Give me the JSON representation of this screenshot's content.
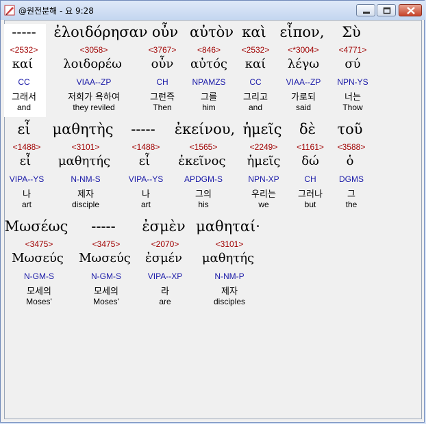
{
  "window": {
    "title": "@원전분해 - 요 9:28"
  },
  "rows": [
    {
      "words": [
        {
          "greek": "-----",
          "strong": "<2532>",
          "lemma": "καί",
          "morph": "CC",
          "korean": "그래서",
          "english": "and"
        },
        {
          "greek": "ἐλοιδόρησαν",
          "strong": "<3058>",
          "lemma": "λοιδορέω",
          "morph": "VIAA--ZP",
          "korean": "저희가 욕하여",
          "english": "they reviled"
        },
        {
          "greek": "οὖν",
          "strong": "<3767>",
          "lemma": "οὖν",
          "morph": "CH",
          "korean": "그런즉",
          "english": "Then"
        },
        {
          "greek": "αὐτὸν",
          "strong": "<846>",
          "lemma": "αὐτός",
          "morph": "NPAMZS",
          "korean": "그를",
          "english": "him"
        },
        {
          "greek": "καὶ",
          "strong": "<2532>",
          "lemma": "καί",
          "morph": "CC",
          "korean": "그리고",
          "english": "and"
        },
        {
          "greek": "εἶπον,",
          "strong": "<*3004>",
          "lemma": "λέγω",
          "morph": "VIAA--ZP",
          "korean": "가로되",
          "english": "said"
        },
        {
          "greek": "Σὺ",
          "strong": "<4771>",
          "lemma": "σύ",
          "morph": "NPN-YS",
          "korean": "너는",
          "english": "Thow"
        }
      ]
    },
    {
      "words": [
        {
          "greek": "εἶ",
          "strong": "<1488>",
          "lemma": "εἶ",
          "morph": "VIPA--YS",
          "korean": "나",
          "english": "art"
        },
        {
          "greek": "μαθητὴς",
          "strong": "<3101>",
          "lemma": "μαθητής",
          "morph": "N-NM-S",
          "korean": "제자",
          "english": "disciple"
        },
        {
          "greek": "-----",
          "strong": "<1488>",
          "lemma": "εἶ",
          "morph": "VIPA--YS",
          "korean": "나",
          "english": "art"
        },
        {
          "greek": "ἐκείνου,",
          "strong": "<1565>",
          "lemma": "ἐκεῖνος",
          "morph": "APDGM-S",
          "korean": "그의",
          "english": "his"
        },
        {
          "greek": "ἡμεῖς",
          "strong": "<2249>",
          "lemma": "ἡμεῖς",
          "morph": "NPN-XP",
          "korean": "우리는",
          "english": "we"
        },
        {
          "greek": "δὲ",
          "strong": "<1161>",
          "lemma": "δώ",
          "morph": "CH",
          "korean": "그러나",
          "english": "but"
        },
        {
          "greek": "τοῦ",
          "strong": "<3588>",
          "lemma": "ὁ",
          "morph": "DGMS",
          "korean": "그",
          "english": "the"
        }
      ]
    },
    {
      "words": [
        {
          "greek": "Μωσέως",
          "strong": "<3475>",
          "lemma": "Μωσεύς",
          "morph": "N-GM-S",
          "korean": "모세의",
          "english": "Moses'"
        },
        {
          "greek": "-----",
          "strong": "<3475>",
          "lemma": "Μωσεύς",
          "morph": "N-GM-S",
          "korean": "모세의",
          "english": "Moses'"
        },
        {
          "greek": "ἐσμὲν",
          "strong": "<2070>",
          "lemma": "ἐσμέν",
          "morph": "VIPA--XP",
          "korean": "라",
          "english": "are"
        },
        {
          "greek": "μαθηταί·",
          "strong": "<3101>",
          "lemma": "μαθητής",
          "morph": "N-NM-P",
          "korean": "제자",
          "english": "disciples"
        }
      ]
    }
  ],
  "icons": {
    "app": "app-icon",
    "minimize": "minimize-icon",
    "maximize": "maximize-icon",
    "close": "close-icon"
  }
}
